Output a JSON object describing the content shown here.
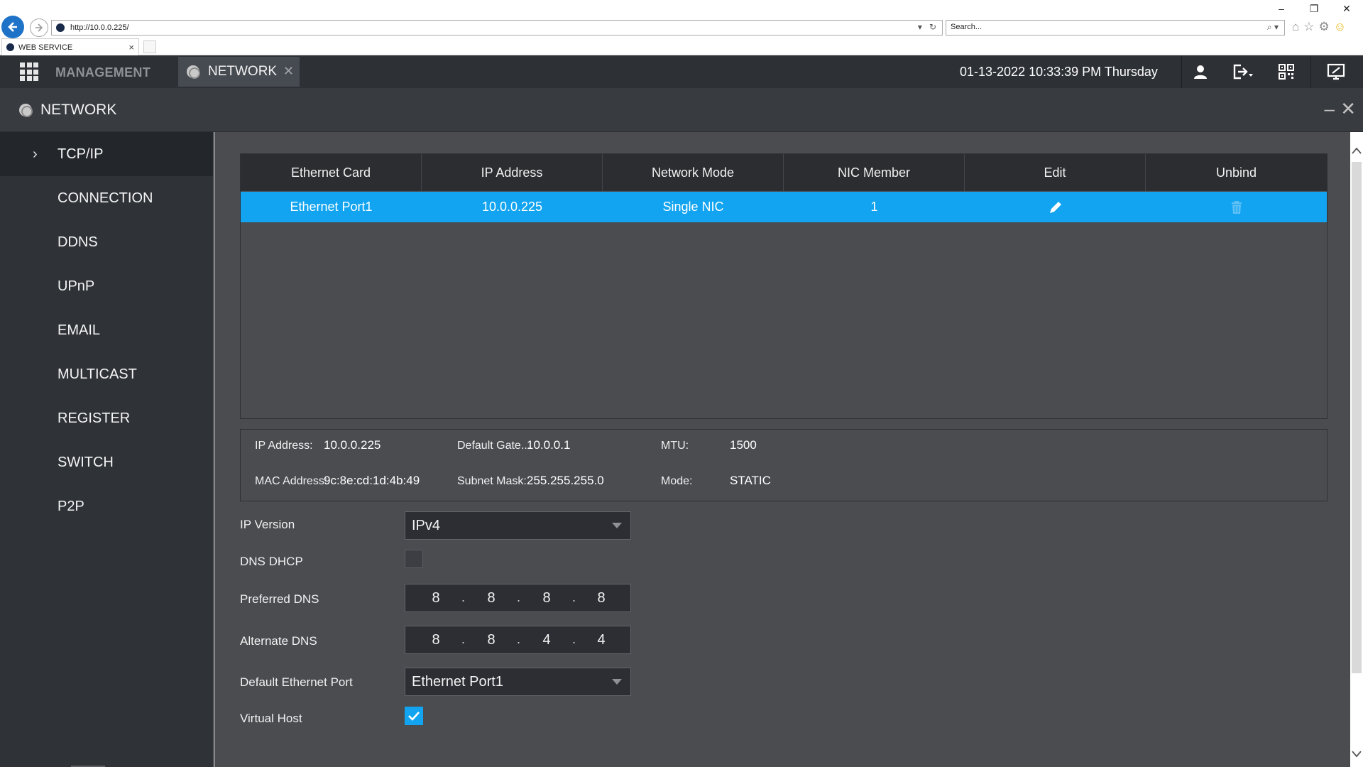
{
  "browser": {
    "url": "http://10.0.0.225/",
    "search_placeholder": "Search...",
    "tab_title": "WEB SERVICE"
  },
  "header": {
    "management_label": "MANAGEMENT",
    "tab_label": "NETWORK",
    "datetime": "01-13-2022 10:33:39 PM Thursday"
  },
  "panel": {
    "title": "NETWORK"
  },
  "sidebar": {
    "items": [
      {
        "label": "TCP/IP",
        "active": true
      },
      {
        "label": "CONNECTION"
      },
      {
        "label": "DDNS"
      },
      {
        "label": "UPnP"
      },
      {
        "label": "EMAIL"
      },
      {
        "label": "MULTICAST"
      },
      {
        "label": "REGISTER"
      },
      {
        "label": "SWITCH"
      },
      {
        "label": "P2P"
      }
    ]
  },
  "table": {
    "headers": [
      "Ethernet Card",
      "IP Address",
      "Network Mode",
      "NIC Member",
      "Edit",
      "Unbind"
    ],
    "rows": [
      {
        "ethernet_card": "Ethernet Port1",
        "ip_address": "10.0.0.225",
        "network_mode": "Single NIC",
        "nic_member": "1"
      }
    ]
  },
  "info": {
    "ip_label": "IP Address:",
    "ip_value": "10.0.0.225",
    "gateway_label": "Default Gate...",
    "gateway_value": "10.0.0.1",
    "mtu_label": "MTU:",
    "mtu_value": "1500",
    "mac_label": "MAC Address:",
    "mac_value": "9c:8e:cd:1d:4b:49",
    "subnet_label": "Subnet Mask:",
    "subnet_value": "255.255.255.0",
    "mode_label": "Mode:",
    "mode_value": "STATIC"
  },
  "form": {
    "ip_version_label": "IP Version",
    "ip_version_value": "IPv4",
    "dns_dhcp_label": "DNS DHCP",
    "dns_dhcp_checked": false,
    "preferred_dns_label": "Preferred DNS",
    "preferred_dns": [
      "8",
      "8",
      "8",
      "8"
    ],
    "alternate_dns_label": "Alternate DNS",
    "alternate_dns": [
      "8",
      "8",
      "4",
      "4"
    ],
    "default_port_label": "Default Ethernet Port",
    "default_port_value": "Ethernet Port1",
    "virtual_host_label": "Virtual Host",
    "virtual_host_checked": true
  },
  "colors": {
    "accent": "#12a4f0",
    "header_bg": "#2d3035",
    "sidebar_bg": "#2f3237",
    "content_bg": "#4a4c50"
  },
  "icons": {
    "edit": "pencil-icon",
    "unbind": "trash-icon",
    "user": "user-icon",
    "logout": "logout-icon",
    "qr": "qr-code-icon",
    "display": "monitor-icon"
  }
}
